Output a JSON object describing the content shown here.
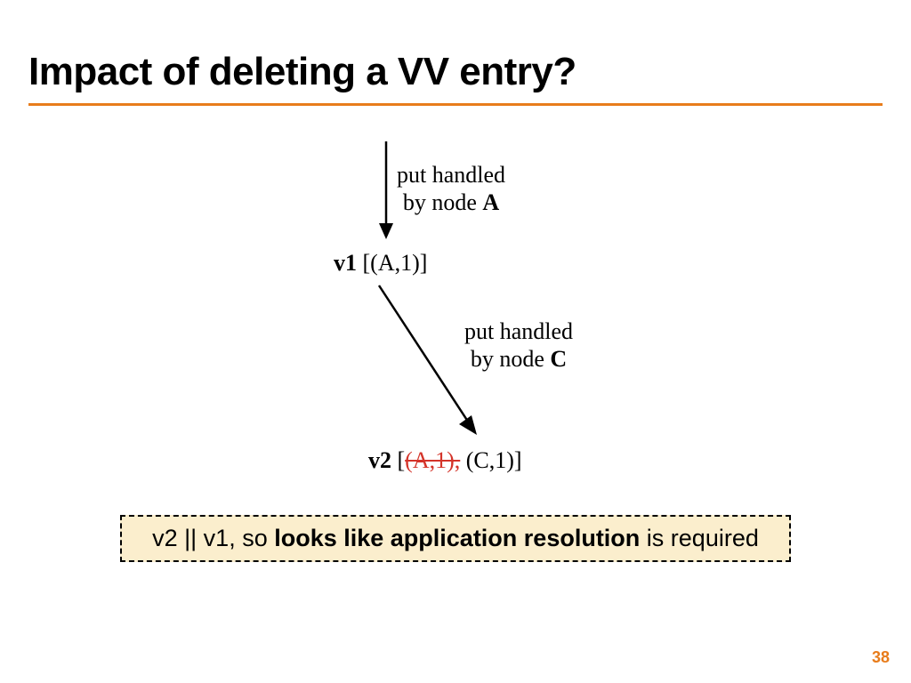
{
  "title": "Impact of deleting a VV entry?",
  "label1_line1": "put handled",
  "label1_line2_a": "by node ",
  "label1_line2_b": "A",
  "v1_bold": "v1",
  "v1_rest": " [(A,1)]",
  "label2_line1": "put handled",
  "label2_line2_a": "by node ",
  "label2_line2_b": "C",
  "v2_bold": "v2",
  "v2_open": " [",
  "v2_strike": "(A,1),",
  "v2_close": " (C,1)]",
  "callout_pre": "v2 || v1, so ",
  "callout_bold": "looks like application resolution",
  "callout_post": " is required",
  "page": "38"
}
